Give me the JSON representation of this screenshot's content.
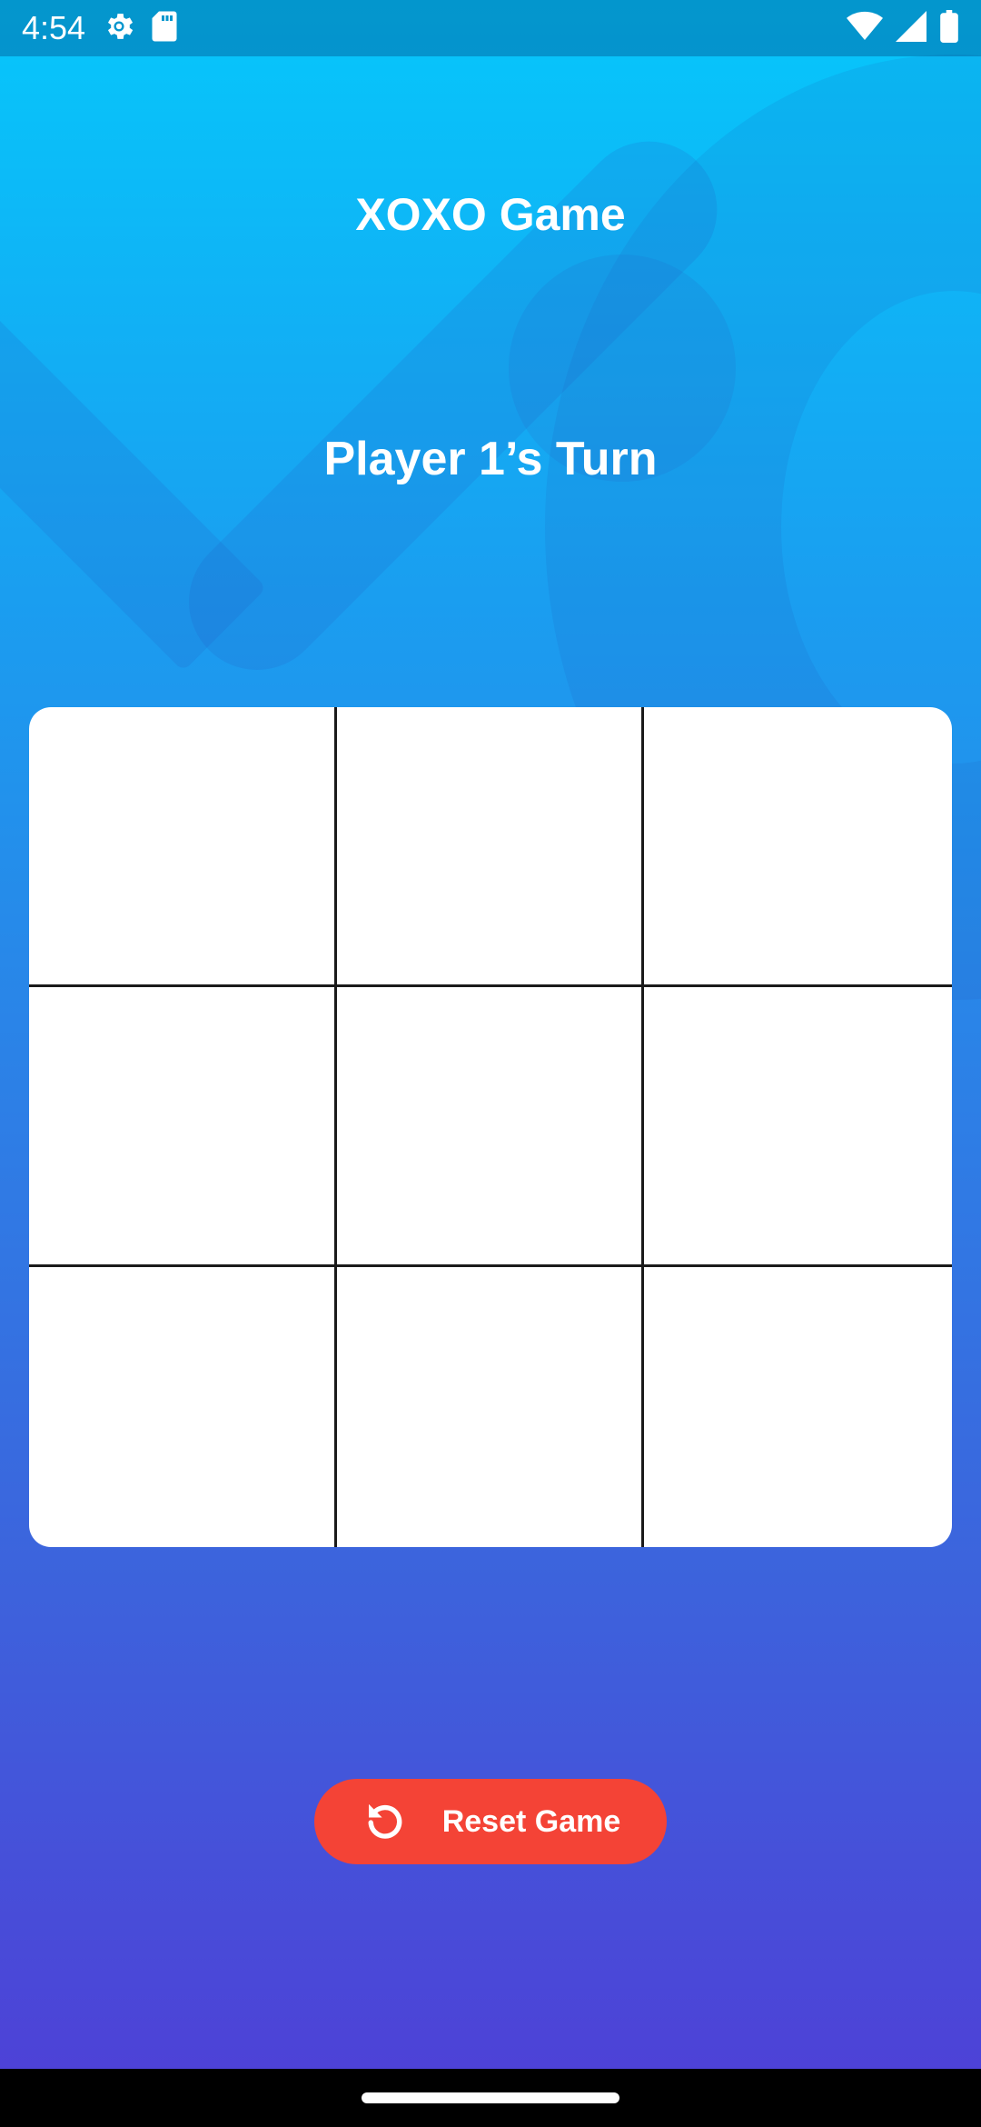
{
  "status_bar": {
    "time": "4:54",
    "left_icons": [
      "settings-gear-icon",
      "sd-card-icon"
    ],
    "right_icons": [
      "wifi-icon",
      "cell-signal-icon",
      "battery-icon"
    ]
  },
  "app": {
    "title": "XOXO Game",
    "turn_label": "Player 1’s Turn"
  },
  "board": {
    "cells": [
      "",
      "",
      "",
      "",
      "",
      "",
      "",
      "",
      ""
    ]
  },
  "reset_button": {
    "label": "Reset Game",
    "icon": "reset-icon",
    "color": "#f44336"
  },
  "colors": {
    "gradient_top": "#06c7fb",
    "gradient_bottom": "#4f3ed6",
    "board_background": "#ffffff",
    "grid_lines": "#1a1a1a"
  }
}
